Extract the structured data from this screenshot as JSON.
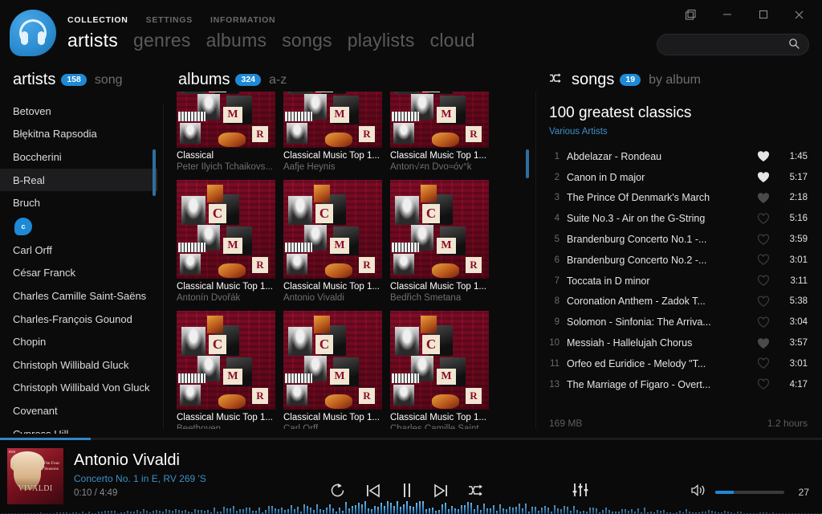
{
  "app": {
    "menu": [
      {
        "label": "COLLECTION",
        "active": true
      },
      {
        "label": "SETTINGS",
        "active": false
      },
      {
        "label": "INFORMATION",
        "active": false
      }
    ],
    "tabs": [
      {
        "label": "artists",
        "active": true
      },
      {
        "label": "genres",
        "active": false
      },
      {
        "label": "albums",
        "active": false
      },
      {
        "label": "songs",
        "active": false
      },
      {
        "label": "playlists",
        "active": false
      },
      {
        "label": "cloud",
        "active": false
      }
    ],
    "window_buttons": [
      {
        "name": "restore-duplicate",
        "glyph": "duplicate"
      },
      {
        "name": "minimize",
        "glyph": "minimize"
      },
      {
        "name": "maximize",
        "glyph": "maximize"
      },
      {
        "name": "close",
        "glyph": "close"
      }
    ],
    "search": {
      "value": "",
      "placeholder": ""
    },
    "accent_color": "#1e8ad6"
  },
  "artists_panel": {
    "title": "artists",
    "count": "158",
    "sort_label": "song",
    "items": [
      {
        "label": "Betoven",
        "selected": false,
        "type": "artist"
      },
      {
        "label": "Błękitna Rapsodia",
        "selected": false,
        "type": "artist"
      },
      {
        "label": "Boccherini",
        "selected": false,
        "type": "artist"
      },
      {
        "label": "B-Real",
        "selected": true,
        "type": "artist"
      },
      {
        "label": "Bruch",
        "selected": false,
        "type": "artist"
      },
      {
        "label": "c",
        "selected": false,
        "type": "letter"
      },
      {
        "label": "Carl Orff",
        "selected": false,
        "type": "artist"
      },
      {
        "label": "César Franck",
        "selected": false,
        "type": "artist"
      },
      {
        "label": "Charles Camille Saint-Saëns",
        "selected": false,
        "type": "artist"
      },
      {
        "label": "Charles-François Gounod",
        "selected": false,
        "type": "artist"
      },
      {
        "label": "Chopin",
        "selected": false,
        "type": "artist"
      },
      {
        "label": "Christoph Willibald Gluck",
        "selected": false,
        "type": "artist"
      },
      {
        "label": "Christoph Willibald Von Gluck",
        "selected": false,
        "type": "artist"
      },
      {
        "label": "Covenant",
        "selected": false,
        "type": "artist"
      },
      {
        "label": "Cypress Hill",
        "selected": false,
        "type": "artist"
      }
    ]
  },
  "albums_panel": {
    "title": "albums",
    "count": "324",
    "sort_label": "a-z",
    "items": [
      {
        "title": "Classical",
        "artist": "Peter Ilyich Tchaikovs...",
        "row": "top"
      },
      {
        "title": "Classical Music Top 1...",
        "artist": "Aafje Heynis",
        "row": "top"
      },
      {
        "title": "Classical Music Top 1...",
        "artist": "Anton√≠n Dvo≈óv°k",
        "row": "top"
      },
      {
        "title": "Classical Music Top 1...",
        "artist": "Antonín Dvořák",
        "row": "mid"
      },
      {
        "title": "Classical Music Top 1...",
        "artist": "Antonio Vivaldi",
        "row": "mid"
      },
      {
        "title": "Classical Music Top 1...",
        "artist": "Bedřich Smetana",
        "row": "mid"
      },
      {
        "title": "Classical Music Top 1...",
        "artist": "Beethoven",
        "row": "bot"
      },
      {
        "title": "Classical Music Top 1...",
        "artist": "Carl Orff",
        "row": "bot"
      },
      {
        "title": "Classical Music Top 1...",
        "artist": "Charles Camille Saint...",
        "row": "bot"
      }
    ]
  },
  "songs_panel": {
    "title": "songs",
    "count": "19",
    "sort_label": "by album",
    "album_name": "100 greatest classics",
    "album_artist": "Various Artists",
    "footer_size": "169 MB",
    "footer_duration": "1.2 hours",
    "tracks": [
      {
        "num": "1",
        "name": "Abdelazar - Rondeau",
        "fav": "full",
        "duration": "1:45"
      },
      {
        "num": "2",
        "name": "Canon in D major",
        "fav": "full",
        "duration": "5:17"
      },
      {
        "num": "3",
        "name": "The Prince Of Denmark's March",
        "fav": "half",
        "duration": "2:18"
      },
      {
        "num": "4",
        "name": "Suite No.3 - Air on the G-String",
        "fav": "empty",
        "duration": "5:16"
      },
      {
        "num": "5",
        "name": "Brandenburg Concerto No.1 -...",
        "fav": "empty",
        "duration": "3:59"
      },
      {
        "num": "6",
        "name": "Brandenburg Concerto No.2 -...",
        "fav": "empty",
        "duration": "3:01"
      },
      {
        "num": "7",
        "name": "Toccata in D minor",
        "fav": "empty",
        "duration": "3:11"
      },
      {
        "num": "8",
        "name": "Coronation Anthem - Zadok T...",
        "fav": "empty",
        "duration": "5:38"
      },
      {
        "num": "9",
        "name": "Solomon - Sinfonia: The Arriva...",
        "fav": "empty",
        "duration": "3:04"
      },
      {
        "num": "10",
        "name": "Messiah - Hallelujah Chorus",
        "fav": "half",
        "duration": "3:57"
      },
      {
        "num": "11",
        "name": "Orfeo ed Euridice - Melody \"T...",
        "fav": "empty",
        "duration": "3:01"
      },
      {
        "num": "13",
        "name": "The Marriage of Figaro - Overt...",
        "fav": "empty",
        "duration": "4:17"
      }
    ]
  },
  "player": {
    "now_playing_artist": "Antonio Vivaldi",
    "now_playing_track": "Concerto No. 1 in E, RV 269 'S",
    "time_display": "0:10 / 4:49",
    "progress_percent": 11,
    "cover": {
      "series_line1": "The Four",
      "series_line2": "Seasons",
      "composer": "VIVALDI",
      "label": "EMI"
    },
    "controls": [
      {
        "name": "repeat-button",
        "icon": "repeat"
      },
      {
        "name": "previous-button",
        "icon": "previous"
      },
      {
        "name": "pause-button",
        "icon": "pause"
      },
      {
        "name": "next-button",
        "icon": "next"
      },
      {
        "name": "shuffle-button",
        "icon": "shuffle"
      }
    ],
    "equalizer": {
      "name": "equalizer-button",
      "icon": "sliders"
    },
    "volume": {
      "value": "27",
      "percent": 27
    }
  }
}
